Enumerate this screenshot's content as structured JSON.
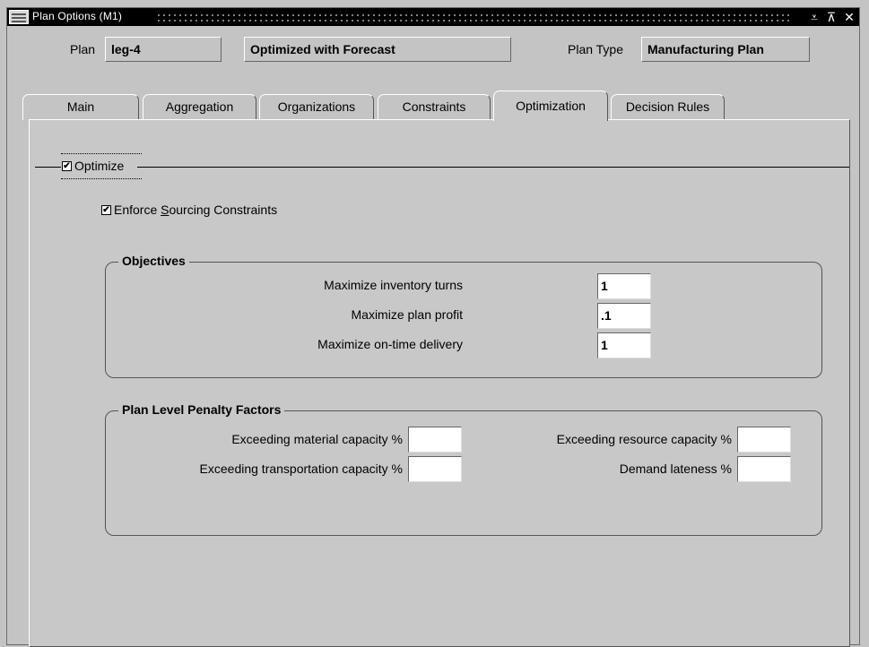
{
  "window": {
    "title": "Plan Options (M1)",
    "controls": {
      "minimize": "⩡",
      "maximize": "⊼",
      "close": "✕"
    }
  },
  "header": {
    "plan_label": "Plan",
    "plan_value": "leg-4",
    "plan_desc": "Optimized with Forecast",
    "plan_type_label": "Plan Type",
    "plan_type_value": "Manufacturing Plan"
  },
  "tabs": [
    {
      "label": "Main",
      "active": false
    },
    {
      "label": "Aggregation",
      "active": false
    },
    {
      "label": "Organizations",
      "active": false
    },
    {
      "label": "Constraints",
      "active": false
    },
    {
      "label": "Optimization",
      "active": true
    },
    {
      "label": "Decision Rules",
      "active": false
    }
  ],
  "optimization": {
    "optimize_label": "Optimize",
    "optimize_checked": true,
    "enforce_label_prefix": "Enforce ",
    "enforce_label_underlined": "S",
    "enforce_label_suffix": "ourcing Constraints",
    "enforce_checked": true,
    "check_mark": "✔"
  },
  "objectives": {
    "title": "Objectives",
    "rows": [
      {
        "label": "Maximize inventory turns",
        "value": "1"
      },
      {
        "label": "Maximize plan profit",
        "value": ".1"
      },
      {
        "label": "Maximize on-time delivery",
        "value": "1"
      }
    ]
  },
  "penalty": {
    "title": "Plan Level Penalty Factors",
    "material_label": "Exceeding material capacity %",
    "material_value": "",
    "transportation_label": "Exceeding transportation capacity %",
    "transportation_value": "",
    "resource_label": "Exceeding resource capacity %",
    "resource_value": "",
    "lateness_label": "Demand lateness %",
    "lateness_value": ""
  }
}
